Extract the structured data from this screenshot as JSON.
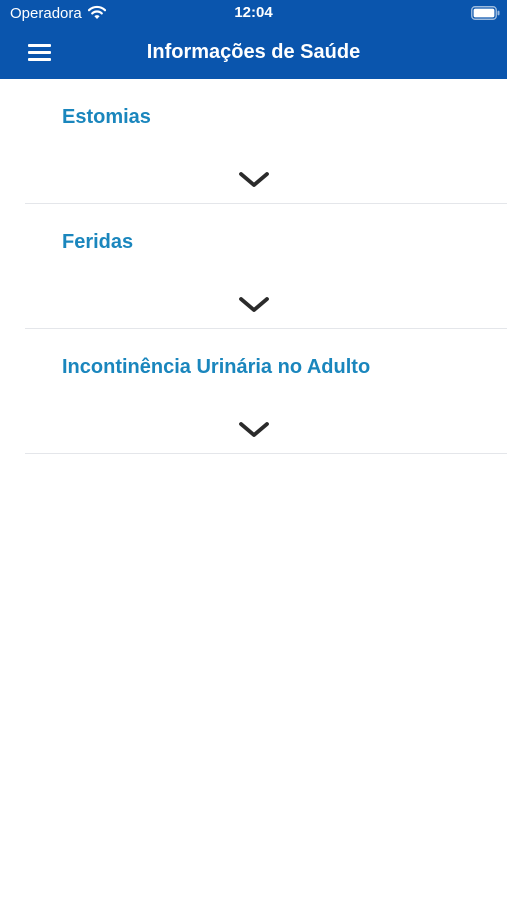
{
  "status_bar": {
    "carrier": "Operadora",
    "time": "12:04",
    "icons": [
      "wifi-icon",
      "battery-icon"
    ]
  },
  "nav_bar": {
    "title": "Informações de Saúde",
    "menu_icon": "hamburger-menu-icon",
    "color": "#0a55ad"
  },
  "sections": [
    {
      "title": "Estomias",
      "icon": "chevron-down-icon"
    },
    {
      "title": "Feridas",
      "icon": "chevron-down-icon"
    },
    {
      "title": "Incontinência Urinária no Adulto",
      "icon": "chevron-down-icon"
    }
  ],
  "colors": {
    "accent": "#1a86bd",
    "divider": "#e4e6ea",
    "chevron": "#2b2b2b"
  }
}
